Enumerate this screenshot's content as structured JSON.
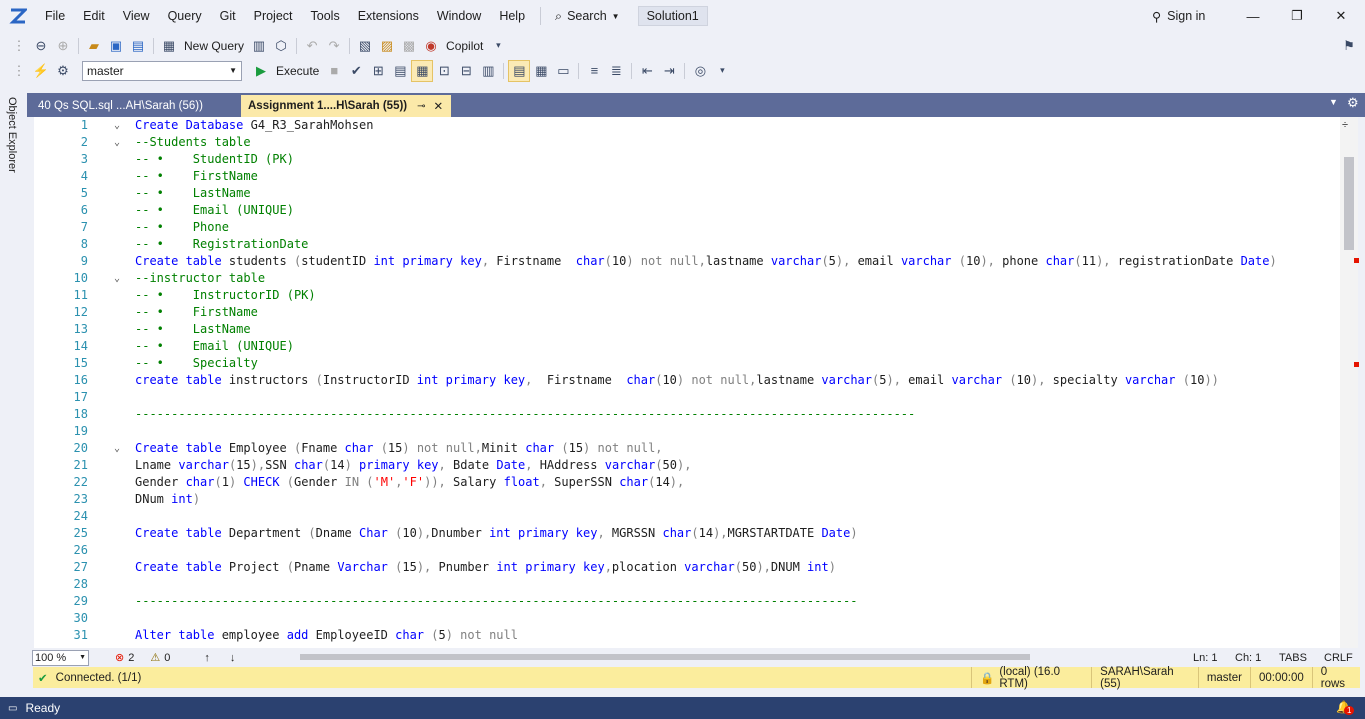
{
  "menu": {
    "items": [
      "File",
      "Edit",
      "View",
      "Query",
      "Git",
      "Project",
      "Tools",
      "Extensions",
      "Window",
      "Help"
    ],
    "search_label": "Search",
    "solution_label": "Solution1",
    "signin_label": "Sign in"
  },
  "toolbar1": {
    "new_query_label": "New Query",
    "copilot_label": "Copilot"
  },
  "toolbar2": {
    "database_value": "master",
    "execute_label": "Execute"
  },
  "side_panel": {
    "label": "Object Explorer"
  },
  "tabs": [
    {
      "label": "40 Qs SQL.sql ...AH\\Sarah (56))"
    },
    {
      "label": "Assignment 1....H\\Sarah (55))"
    }
  ],
  "editor": {
    "lines": [
      {
        "n": "1",
        "fold": "⌄",
        "html": "<span class=\"kw\">Create Database</span> G4_R3_SarahMohsen"
      },
      {
        "n": "2",
        "fold": "⌄",
        "html": "<span class=\"cm\">--Students table</span>"
      },
      {
        "n": "3",
        "fold": "",
        "html": "<span class=\"cm\">-- •    StudentID (PK)</span>"
      },
      {
        "n": "4",
        "fold": "",
        "html": "<span class=\"cm\">-- •    FirstName</span>"
      },
      {
        "n": "5",
        "fold": "",
        "html": "<span class=\"cm\">-- •    LastName</span>"
      },
      {
        "n": "6",
        "fold": "",
        "html": "<span class=\"cm\">-- •    Email (UNIQUE)</span>"
      },
      {
        "n": "7",
        "fold": "",
        "html": "<span class=\"cm\">-- •    Phone</span>"
      },
      {
        "n": "8",
        "fold": "",
        "html": "<span class=\"cm\">-- •    RegistrationDate</span>"
      },
      {
        "n": "9",
        "fold": "",
        "html": "<span class=\"kw\">Create table</span> students <span class=\"gr\">(</span>studentID <span class=\"kw\">int primary key</span><span class=\"gr\">,</span> Firstname  <span class=\"kw\">char</span><span class=\"gr\">(</span>10<span class=\"gr\">) not null,</span>lastname <span class=\"kw\">varchar</span><span class=\"gr\">(</span>5<span class=\"gr\">),</span> email <span class=\"kw\">varchar</span> <span class=\"gr\">(</span>10<span class=\"gr\">),</span> phone <span class=\"kw\">char</span><span class=\"gr\">(</span>11<span class=\"gr\">),</span> registrationDate <span class=\"kw\">Date</span><span class=\"gr\">)</span>"
      },
      {
        "n": "10",
        "fold": "⌄",
        "html": "<span class=\"cm\">--instructor table</span>"
      },
      {
        "n": "11",
        "fold": "",
        "html": "<span class=\"cm\">-- •    InstructorID (PK)</span>"
      },
      {
        "n": "12",
        "fold": "",
        "html": "<span class=\"cm\">-- •    FirstName</span>"
      },
      {
        "n": "13",
        "fold": "",
        "html": "<span class=\"cm\">-- •    LastName</span>"
      },
      {
        "n": "14",
        "fold": "",
        "html": "<span class=\"cm\">-- •    Email (UNIQUE)</span>"
      },
      {
        "n": "15",
        "fold": "",
        "html": "<span class=\"cm\">-- •    Specialty</span>"
      },
      {
        "n": "16",
        "fold": "",
        "html": "<span class=\"kw\">create table</span> instructors <span class=\"gr\">(</span>InstructorID <span class=\"kw\">int primary key</span><span class=\"gr\">,</span>  Firstname  <span class=\"kw\">char</span><span class=\"gr\">(</span>10<span class=\"gr\">) not null,</span>lastname <span class=\"kw\">varchar</span><span class=\"gr\">(</span>5<span class=\"gr\">),</span> email <span class=\"kw\">varchar</span> <span class=\"gr\">(</span>10<span class=\"gr\">),</span> specialty <span class=\"kw\">varchar</span> <span class=\"gr\">(</span>10<span class=\"gr\">))</span>"
      },
      {
        "n": "17",
        "fold": "",
        "html": ""
      },
      {
        "n": "18",
        "fold": "",
        "html": "<span class=\"cm\">------------------------------------------------------------------------------------------------------------</span>"
      },
      {
        "n": "19",
        "fold": "",
        "html": ""
      },
      {
        "n": "20",
        "fold": "⌄",
        "html": "<span class=\"kw\">Create table</span> Employee <span class=\"gr\">(</span>Fname <span class=\"kw\">char</span> <span class=\"gr\">(</span>15<span class=\"gr\">) not null,</span>Minit <span class=\"kw\">char</span> <span class=\"gr\">(</span>15<span class=\"gr\">) not null,</span>"
      },
      {
        "n": "21",
        "fold": "",
        "html": "Lname <span class=\"kw\">varchar</span><span class=\"gr\">(</span>15<span class=\"gr\">),</span>SSN <span class=\"kw\">char</span><span class=\"gr\">(</span>14<span class=\"gr\">)</span> <span class=\"kw\">primary key</span><span class=\"gr\">,</span> Bdate <span class=\"kw\">Date</span><span class=\"gr\">,</span> HAddress <span class=\"kw\">varchar</span><span class=\"gr\">(</span>50<span class=\"gr\">),</span>"
      },
      {
        "n": "22",
        "fold": "",
        "html": "Gender <span class=\"kw\">char</span><span class=\"gr\">(</span>1<span class=\"gr\">)</span> <span class=\"kw\">CHECK</span> <span class=\"gr\">(</span>Gender <span class=\"gr\">IN (</span><span class=\"st\">'M'</span><span class=\"gr\">,</span><span class=\"st\">'F'</span><span class=\"gr\">)),</span> Salary <span class=\"kw\">float</span><span class=\"gr\">,</span> SuperSSN <span class=\"kw\">char</span><span class=\"gr\">(</span>14<span class=\"gr\">),</span>"
      },
      {
        "n": "23",
        "fold": "",
        "html": "DNum <span class=\"kw\">int</span><span class=\"gr\">)</span>"
      },
      {
        "n": "24",
        "fold": "",
        "html": ""
      },
      {
        "n": "25",
        "fold": "",
        "html": "<span class=\"kw\">Create table</span> Department <span class=\"gr\">(</span>Dname <span class=\"kw\">Char</span> <span class=\"gr\">(</span>10<span class=\"gr\">),</span>Dnumber <span class=\"kw\">int primary key</span><span class=\"gr\">,</span> MGRSSN <span class=\"kw\">char</span><span class=\"gr\">(</span>14<span class=\"gr\">),</span>MGRSTARTDATE <span class=\"kw\">Date</span><span class=\"gr\">)</span>"
      },
      {
        "n": "26",
        "fold": "",
        "html": ""
      },
      {
        "n": "27",
        "fold": "",
        "html": "<span class=\"kw\">Create table</span> Project <span class=\"gr\">(</span>Pname <span class=\"kw\">Varchar</span> <span class=\"gr\">(</span>15<span class=\"gr\">),</span> Pnumber <span class=\"kw\">int primary key</span><span class=\"gr\">,</span>plocation <span class=\"kw\">varchar</span><span class=\"gr\">(</span>50<span class=\"gr\">),</span>DNUM <span class=\"kw\">int</span><span class=\"gr\">)</span>"
      },
      {
        "n": "28",
        "fold": "",
        "html": ""
      },
      {
        "n": "29",
        "fold": "",
        "html": "<span class=\"cm\">----------------------------------------------------------------------------------------------------</span>"
      },
      {
        "n": "30",
        "fold": "",
        "html": ""
      },
      {
        "n": "31",
        "fold": "",
        "html": "<span class=\"kw\">Alter table</span> employee <span class=\"kw\">add</span> EmployeeID <span class=\"kw\">char</span> <span class=\"gr\">(</span>5<span class=\"gr\">) not null</span>"
      }
    ]
  },
  "editor_status": {
    "zoom": "100 %",
    "errors": "2",
    "warnings": "0",
    "ln": "Ln: 1",
    "ch": "Ch: 1",
    "tabs": "TABS",
    "crlf": "CRLF"
  },
  "connection": {
    "status": "Connected. (1/1)",
    "server": "(local) (16.0 RTM)",
    "user": "SARAH\\Sarah (55)",
    "db": "master",
    "time": "00:00:00",
    "rows": "0 rows"
  },
  "statusbar": {
    "text": "Ready",
    "notif_count": "1"
  },
  "colors": {
    "accent": "#2b4170",
    "tab_active": "#fbe9a9",
    "tabstrip": "#5d6b99",
    "connection_bar": "#fbed9d"
  }
}
